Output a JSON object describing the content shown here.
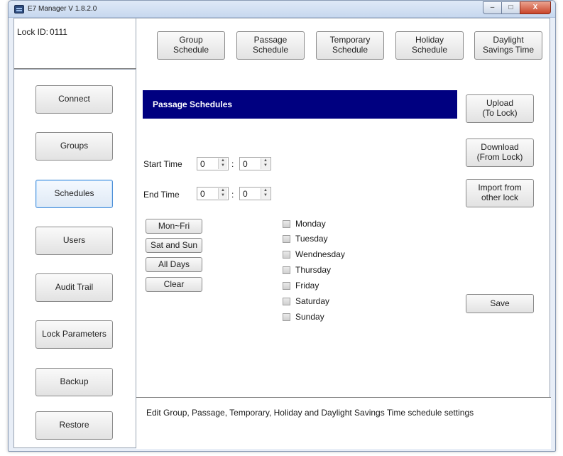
{
  "window": {
    "title": "E7 Manager V 1.8.2.0",
    "controls": {
      "minimize": "–",
      "maximize": "□",
      "close": "X"
    }
  },
  "lock": {
    "label": "Lock ID:",
    "value": "0111"
  },
  "sidebar": {
    "items": [
      {
        "label": "Connect"
      },
      {
        "label": "Groups"
      },
      {
        "label": "Schedules",
        "active": true
      },
      {
        "label": "Users"
      },
      {
        "label": "Audit Trail"
      },
      {
        "label": "Lock Parameters"
      },
      {
        "label": "Backup"
      },
      {
        "label": "Restore"
      }
    ]
  },
  "tabs": [
    {
      "label": "Group\nSchedule"
    },
    {
      "label": "Passage\nSchedule"
    },
    {
      "label": "Temporary\nSchedule"
    },
    {
      "label": "Holiday\nSchedule"
    },
    {
      "label": "Daylight\nSavings Time"
    }
  ],
  "header": {
    "title": "Passage Schedules"
  },
  "start_time": {
    "label": "Start Time",
    "hour": "0",
    "minute": "0",
    "separator": ":"
  },
  "end_time": {
    "label": "End Time",
    "hour": "0",
    "minute": "0",
    "separator": ":"
  },
  "quick_buttons": [
    {
      "label": "Mon~Fri"
    },
    {
      "label": "Sat and Sun"
    },
    {
      "label": "All Days"
    },
    {
      "label": "Clear"
    }
  ],
  "days": [
    {
      "label": "Monday",
      "checked": false
    },
    {
      "label": "Tuesday",
      "checked": false
    },
    {
      "label": "Wendnesday",
      "checked": false
    },
    {
      "label": "Thursday",
      "checked": false
    },
    {
      "label": "Friday",
      "checked": false
    },
    {
      "label": "Saturday",
      "checked": false
    },
    {
      "label": "Sunday",
      "checked": false
    }
  ],
  "right_actions": {
    "upload": "Upload\n(To Lock)",
    "download": "Download\n(From Lock)",
    "import": "Import from\nother lock",
    "save": "Save"
  },
  "status": {
    "help_text": "Edit Group, Passage, Temporary, Holiday and Daylight Savings Time schedule settings"
  },
  "colors": {
    "header_bg": "#000080",
    "active_border": "#4d8fd6"
  }
}
